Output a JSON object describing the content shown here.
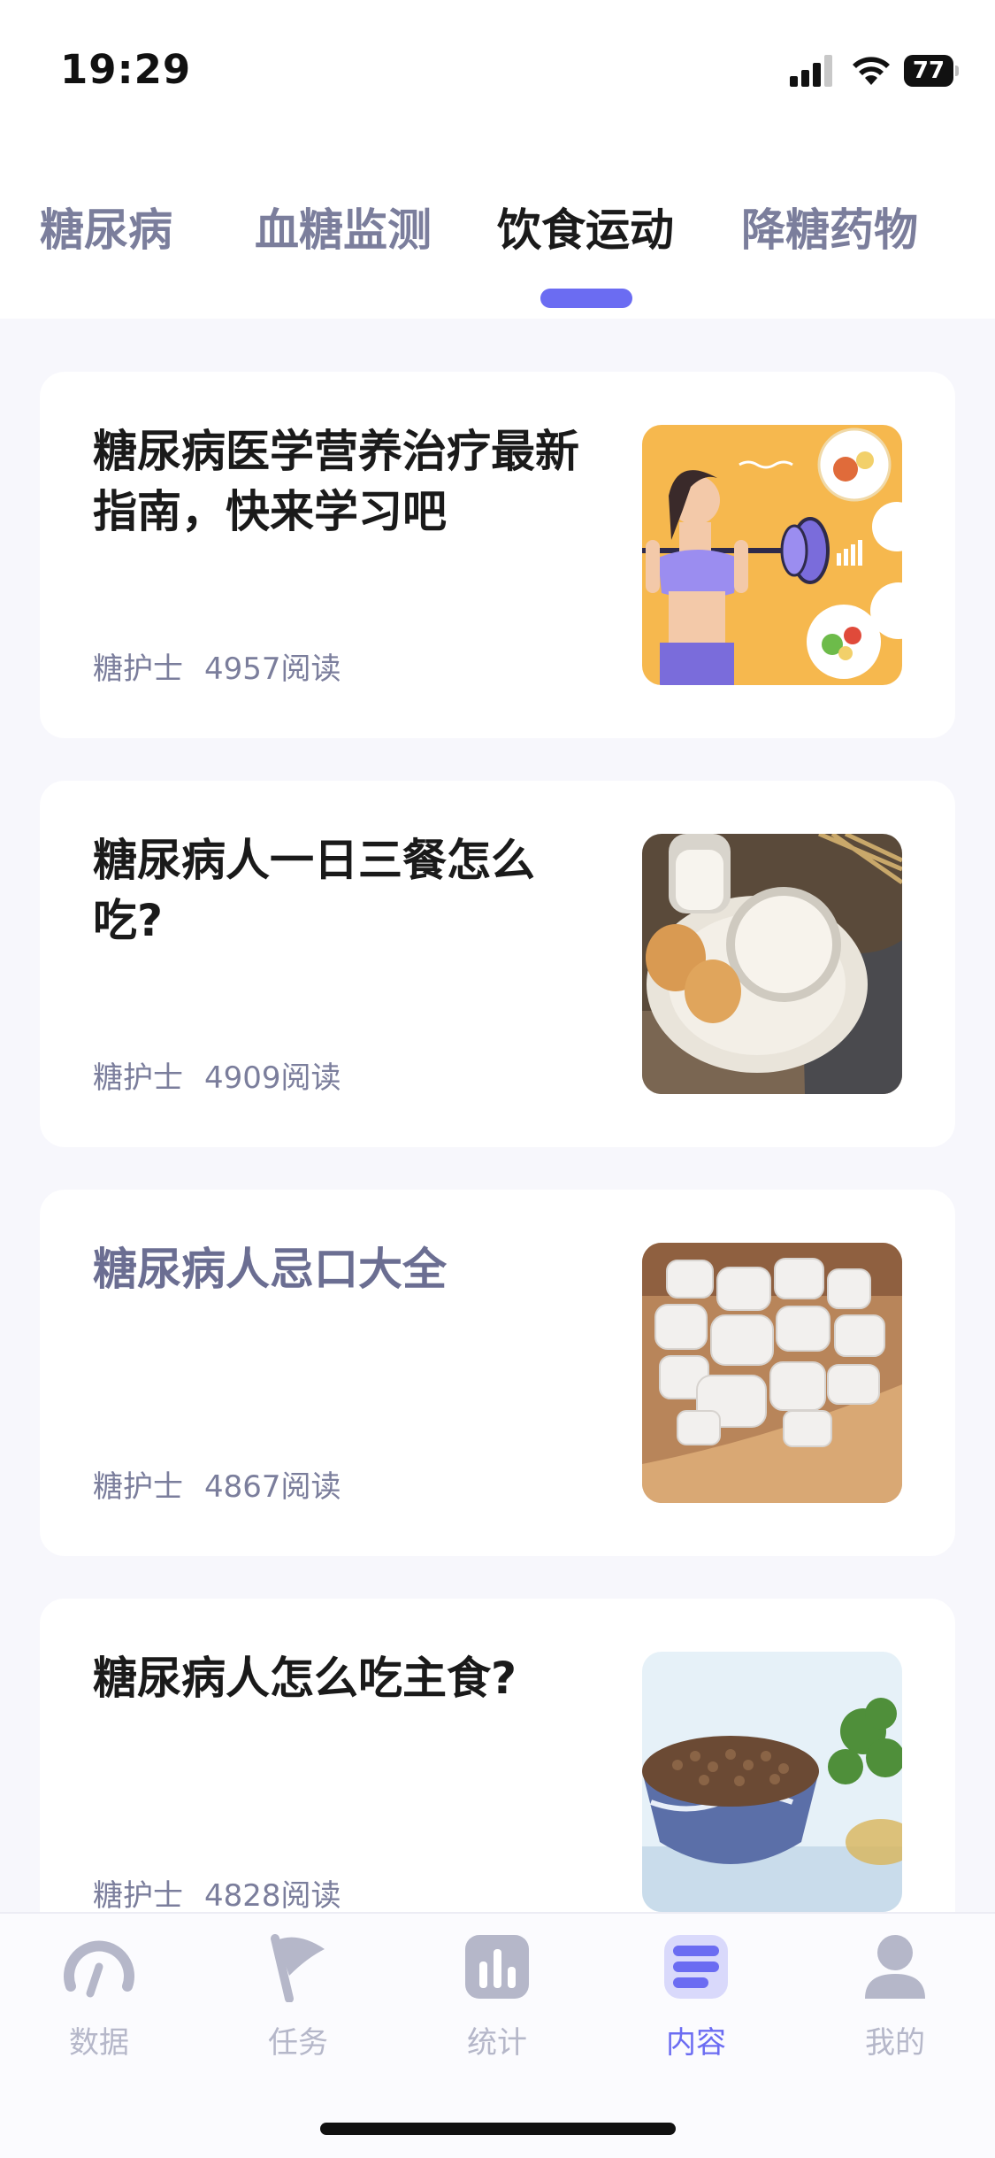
{
  "status_bar": {
    "time": "19:29",
    "battery": "77"
  },
  "tabs": [
    {
      "label": "糖尿病",
      "active": false
    },
    {
      "label": "血糖监测",
      "active": false
    },
    {
      "label": "饮食运动",
      "active": true
    },
    {
      "label": "降糖药物",
      "active": false
    }
  ],
  "articles": [
    {
      "title": "糖尿病医学营养治疗最新指南，快来学习吧",
      "author": "糖护士",
      "reads": "4957阅读",
      "image": "fitness-diet-illustration"
    },
    {
      "title": "糖尿病人一日三餐怎么吃?",
      "author": "糖护士",
      "reads": "4909阅读",
      "image": "milk-and-eggs-photo"
    },
    {
      "title": "糖尿病人忌口大全",
      "author": "糖护士",
      "reads": "4867阅读",
      "image": "rock-sugar-photo"
    },
    {
      "title": "糖尿病人怎么吃主食?",
      "author": "糖护士",
      "reads": "4828阅读",
      "image": "grain-bowl-photo"
    }
  ],
  "bottom_nav": [
    {
      "label": "数据",
      "icon": "gauge-icon",
      "active": false
    },
    {
      "label": "任务",
      "icon": "flag-icon",
      "active": false
    },
    {
      "label": "统计",
      "icon": "bar-chart-icon",
      "active": false
    },
    {
      "label": "内容",
      "icon": "content-list-icon",
      "active": true
    },
    {
      "label": "我的",
      "icon": "user-icon",
      "active": false
    }
  ],
  "colors": {
    "accent": "#6b6cf2",
    "inactive": "#b5b7c9",
    "tab_inactive": "#7b7e9c"
  }
}
